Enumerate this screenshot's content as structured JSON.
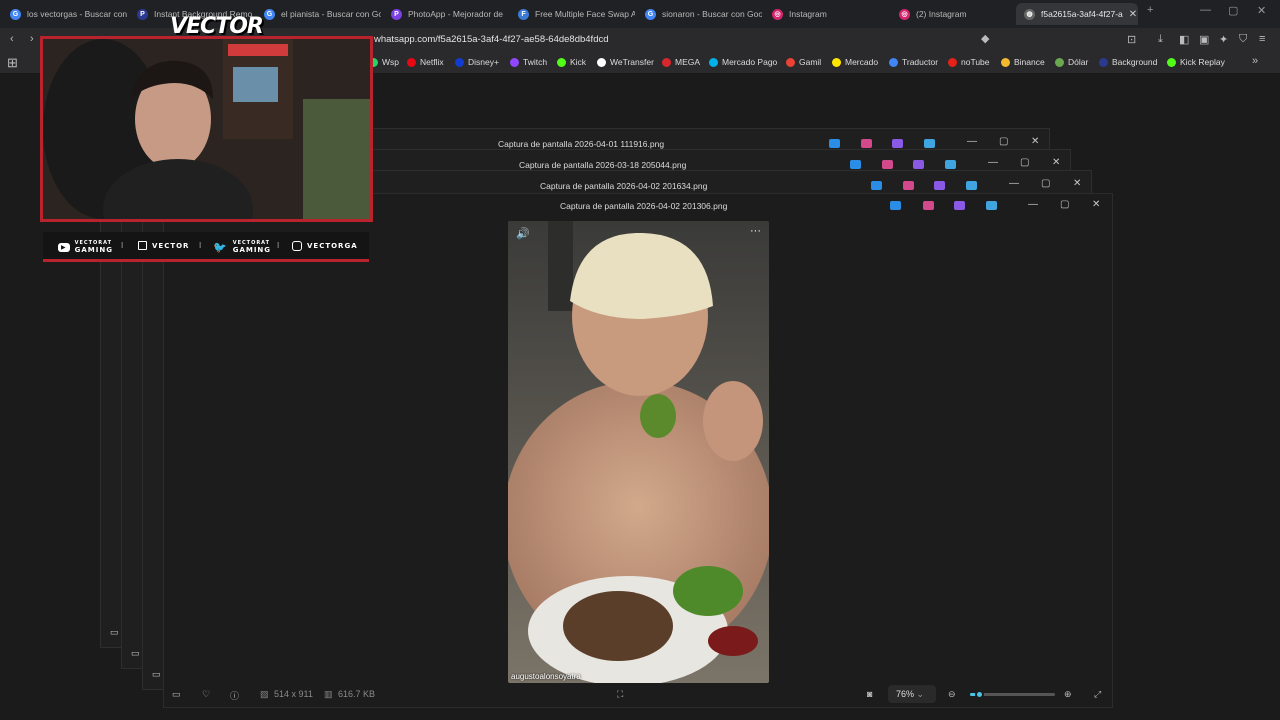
{
  "tabs": [
    {
      "label": "los vectorgas - Buscar con",
      "color": "#4285f4"
    },
    {
      "label": "Instant Background Remo",
      "color": "#2b3a8f"
    },
    {
      "label": "el pianista - Buscar con Go",
      "color": "#4285f4"
    },
    {
      "label": "PhotoApp - Mejorador de",
      "color": "#7b3fe4"
    },
    {
      "label": "Free Multiple Face Swap A",
      "color": "#3b7bd4"
    },
    {
      "label": "sionaron - Buscar con Goo",
      "color": "#4285f4"
    },
    {
      "label": "Instagram",
      "color": "#d6246e"
    },
    {
      "label": "(2) Instagram",
      "color": "#d6246e"
    },
    {
      "label": "f5a2615a-3af4-4f27-a",
      "color": "#888888"
    }
  ],
  "new_tab": "+",
  "url": "whatsapp.com/f5a2615a-3af4-4f27-ae58-64de8db4fdcd",
  "bookmarks": [
    {
      "label": "Wsp",
      "color": "#25d366"
    },
    {
      "label": "Netflix",
      "color": "#e50914"
    },
    {
      "label": "Disney+",
      "color": "#113ccf"
    },
    {
      "label": "Twitch",
      "color": "#9146ff"
    },
    {
      "label": "Kick",
      "color": "#53fc18"
    },
    {
      "label": "WeTransfer",
      "color": "#ffffff"
    },
    {
      "label": "MEGA",
      "color": "#d9272e"
    },
    {
      "label": "Mercado Pago",
      "color": "#00b1ea"
    },
    {
      "label": "Gamil",
      "color": "#ea4335"
    },
    {
      "label": "Mercado",
      "color": "#ffe600"
    },
    {
      "label": "Traductor",
      "color": "#4285f4"
    },
    {
      "label": "noTube",
      "color": "#e62117"
    },
    {
      "label": "Binance",
      "color": "#f3ba2f"
    },
    {
      "label": "Dólar",
      "color": "#6aa84f"
    },
    {
      "label": "Background",
      "color": "#2b3a8f"
    },
    {
      "label": "Kick Replay",
      "color": "#53fc18"
    }
  ],
  "windows": [
    {
      "title": "Captura de pantalla 2026-04-01 111916.png"
    },
    {
      "title": "Captura de pantalla 2026-03-18 205044.png"
    },
    {
      "title": "Captura de pantalla 2026-04-02 201634.png"
    }
  ],
  "viewer": {
    "title": "Captura de pantalla 2026-04-02 201306.png",
    "dimensions": "514 x 911",
    "filesize": "616.7 KB",
    "zoom": "76%",
    "zoom_level": 0.1,
    "photo_credit": "augustoalonsoyatra",
    "more": "···"
  },
  "overlay": {
    "brand": "VECTOR",
    "socials": [
      {
        "icon": "youtube-icon",
        "line1": "VECTORAT",
        "line2": "GAMING"
      },
      {
        "icon": "twitch-icon",
        "line1": "VECTOR",
        "line2": ""
      },
      {
        "icon": "twitter-icon",
        "line1": "VECTORAT",
        "line2": "GAMING"
      },
      {
        "icon": "instagram-icon",
        "line1": "VECTORGA",
        "line2": ""
      }
    ]
  },
  "colors": {
    "accent_red": "#b8232e",
    "chrome_dark": "#202124"
  }
}
